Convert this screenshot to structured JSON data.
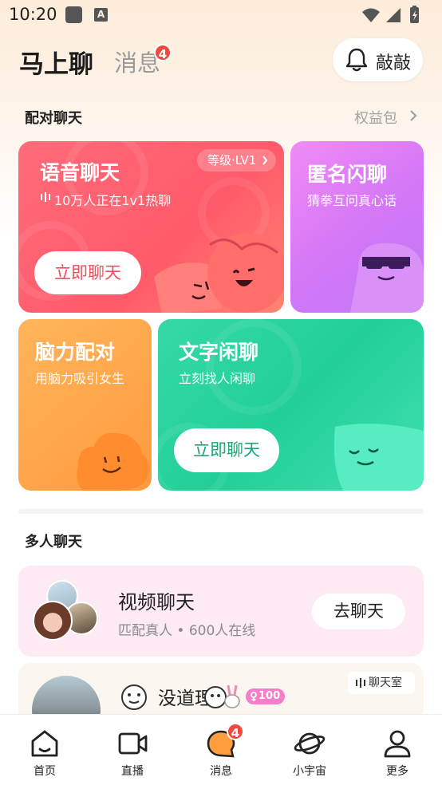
{
  "status_bar": {
    "time": "10:20",
    "a_icon_text": "A"
  },
  "header": {
    "tab_main": "马上聊",
    "tab_messages": "消息",
    "messages_badge": "4",
    "knock_button": "敲敲"
  },
  "match_section": {
    "title": "配对聊天",
    "benefit_link": "权益包",
    "cards": {
      "voice": {
        "title": "语音聊天",
        "level": "等级·LV1",
        "subtitle": "10万人正在1v1热聊",
        "cta": "立即聊天"
      },
      "anonymous": {
        "title": "匿名闪聊",
        "subtitle": "猜拳互问真心话"
      },
      "brain": {
        "title": "脑力配对",
        "subtitle": "用脑力吸引女生"
      },
      "text": {
        "title": "文字闲聊",
        "subtitle": "立刻找人闲聊",
        "cta": "立即聊天"
      }
    }
  },
  "group_section": {
    "title": "多人聊天",
    "video_chat": {
      "title": "视频聊天",
      "subtitle": "匹配真人 • 600人在线",
      "button": "去聊天"
    },
    "chat_room": {
      "tag": "聊天室",
      "title": "没道理",
      "level_badge": "100"
    }
  },
  "bottom_nav": [
    {
      "label": "首页",
      "icon": "home-icon"
    },
    {
      "label": "直播",
      "icon": "video-camera-icon"
    },
    {
      "label": "消息",
      "icon": "message-icon",
      "badge": "4",
      "active": true
    },
    {
      "label": "小宇宙",
      "icon": "planet-icon"
    },
    {
      "label": "更多",
      "icon": "person-icon"
    }
  ],
  "colors": {
    "voice_card": "#ff5a6a",
    "anon_card": "#d276f6",
    "brain_card": "#ff9a3e",
    "text_card": "#22cf97",
    "badge": "#f0483e",
    "video_row_bg": "#fdeaf5"
  }
}
